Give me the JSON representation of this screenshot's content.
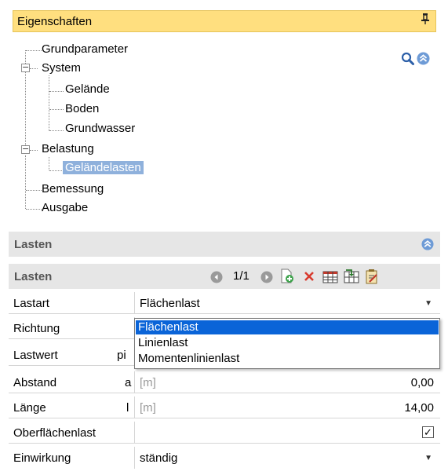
{
  "panel": {
    "title": "Eigenschaften",
    "pin_glyph": "▐"
  },
  "tree": {
    "grundparameter": "Grundparameter",
    "system": "System",
    "gelaende": "Gelände",
    "boden": "Boden",
    "grundwasser": "Grundwasser",
    "belastung": "Belastung",
    "gelaendelasten": "Geländelasten",
    "bemessung": "Bemessung",
    "ausgabe": "Ausgabe",
    "expander_glyph": "−"
  },
  "section1": {
    "label": "Lasten",
    "collapse_glyph": "︽"
  },
  "section2": {
    "label": "Lasten",
    "page": "1/1"
  },
  "grid": {
    "lastart": {
      "name": "Lastart",
      "value": "Flächenlast"
    },
    "richtung": {
      "name": "Richtung"
    },
    "lastwert": {
      "name": "Lastwert",
      "symbol": "pi"
    },
    "abstand": {
      "name": "Abstand",
      "symbol": "a",
      "unit": "[m]",
      "value": "0,00"
    },
    "laenge": {
      "name": "Länge",
      "symbol": "l",
      "unit": "[m]",
      "value": "14,00"
    },
    "oberflaechenlast": {
      "name": "Oberflächenlast",
      "checked": "✓"
    },
    "einwirkung": {
      "name": "Einwirkung",
      "value": "ständig"
    },
    "arrow_glyph": "▼"
  },
  "dropdown": {
    "options": [
      "Flächenlast",
      "Linienlast",
      "Momentenlinienlast"
    ],
    "selected": "Flächenlast"
  },
  "colors": {
    "title_bg": "#ffdf7f",
    "selection_blue": "#0a64d8",
    "tree_selected": "#8fb1dc",
    "section_bg": "#e6e6e6"
  }
}
